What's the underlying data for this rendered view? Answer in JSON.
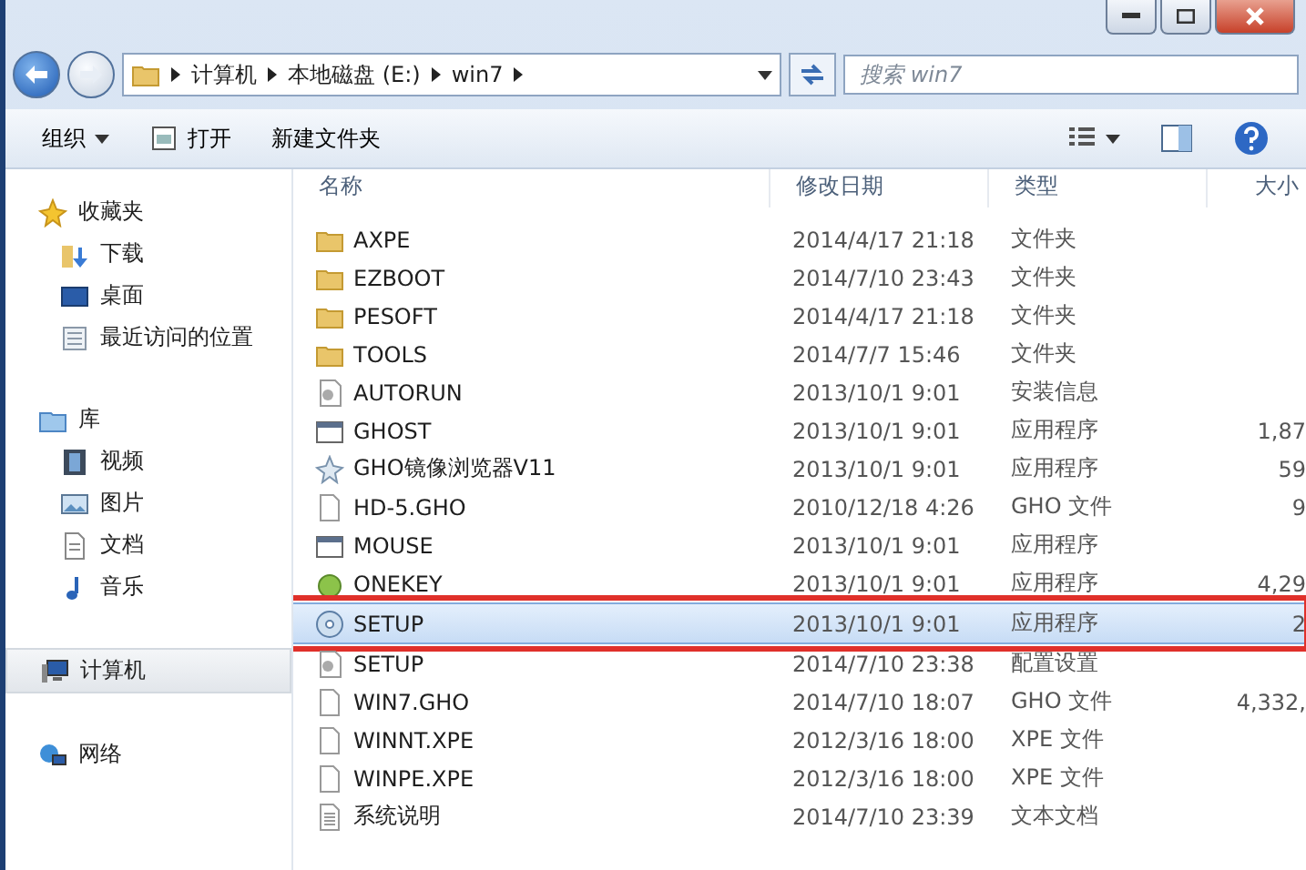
{
  "address": {
    "crumbs": [
      "计算机",
      "本地磁盘 (E:)",
      "win7"
    ]
  },
  "search": {
    "placeholder": "搜索 win7"
  },
  "toolbar": {
    "buttons": [
      {
        "label": "组织",
        "kind": "menu"
      },
      {
        "label": "打开",
        "kind": "open"
      },
      {
        "label": "新建文件夹",
        "kind": "plain"
      }
    ]
  },
  "sidebar": {
    "groups": [
      {
        "label": "收藏夹",
        "kind": "star",
        "selected": false,
        "children": [
          {
            "label": "下载",
            "kind": "download"
          },
          {
            "label": "桌面",
            "kind": "desktop"
          },
          {
            "label": "最近访问的位置",
            "kind": "recent"
          }
        ]
      },
      {
        "label": "库",
        "kind": "library",
        "selected": false,
        "children": [
          {
            "label": "视频",
            "kind": "video"
          },
          {
            "label": "图片",
            "kind": "picture"
          },
          {
            "label": "文档",
            "kind": "doc"
          },
          {
            "label": "音乐",
            "kind": "music"
          }
        ]
      },
      {
        "label": "计算机",
        "kind": "computer",
        "selected": true
      },
      {
        "label": "网络",
        "kind": "network",
        "selected": false
      }
    ]
  },
  "table": {
    "columns": [
      "名称",
      "修改日期",
      "类型",
      "大小"
    ],
    "rows": [
      {
        "name": "AXPE",
        "date": "2014/4/17 21:18",
        "type": "文件夹",
        "kind": "folder",
        "selected": false
      },
      {
        "name": "EZBOOT",
        "date": "2014/7/10 23:43",
        "type": "文件夹",
        "kind": "folder",
        "selected": false
      },
      {
        "name": "PESOFT",
        "date": "2014/4/17 21:18",
        "type": "文件夹",
        "kind": "folder",
        "selected": false
      },
      {
        "name": "TOOLS",
        "date": "2014/7/7 15:46",
        "type": "文件夹",
        "kind": "folder",
        "selected": false
      },
      {
        "name": "AUTORUN",
        "date": "2013/10/1 9:01",
        "type": "安装信息",
        "kind": "config",
        "selected": false
      },
      {
        "name": "GHOST",
        "date": "2013/10/1 9:01",
        "type": "应用程序",
        "size": "1,87",
        "kind": "app",
        "selected": false
      },
      {
        "name": "GHO镜像浏览器V11",
        "date": "2013/10/1 9:01",
        "type": "应用程序",
        "size": "59",
        "kind": "tool",
        "selected": false
      },
      {
        "name": "HD-5.GHO",
        "date": "2010/12/18 4:26",
        "type": "GHO 文件",
        "size": "9",
        "kind": "file",
        "selected": false
      },
      {
        "name": "MOUSE",
        "date": "2013/10/1 9:01",
        "type": "应用程序",
        "kind": "app",
        "selected": false
      },
      {
        "name": "ONEKEY",
        "date": "2013/10/1 9:01",
        "type": "应用程序",
        "size": "4,29",
        "kind": "onekey",
        "selected": false
      },
      {
        "name": "SETUP",
        "date": "2013/10/1 9:01",
        "type": "应用程序",
        "size": "2",
        "kind": "installer",
        "selected": true
      },
      {
        "name": "SETUP",
        "date": "2014/7/10 23:38",
        "type": "配置设置",
        "kind": "config",
        "selected": false
      },
      {
        "name": "WIN7.GHO",
        "date": "2014/7/10 18:07",
        "type": "GHO 文件",
        "size": "4,332,",
        "kind": "file",
        "selected": false
      },
      {
        "name": "WINNT.XPE",
        "date": "2012/3/16 18:00",
        "type": "XPE 文件",
        "kind": "file",
        "selected": false
      },
      {
        "name": "WINPE.XPE",
        "date": "2012/3/16 18:00",
        "type": "XPE 文件",
        "kind": "file",
        "selected": false
      },
      {
        "name": "系统说明",
        "date": "2014/7/10 23:39",
        "type": "文本文档",
        "kind": "text",
        "selected": false
      }
    ]
  }
}
